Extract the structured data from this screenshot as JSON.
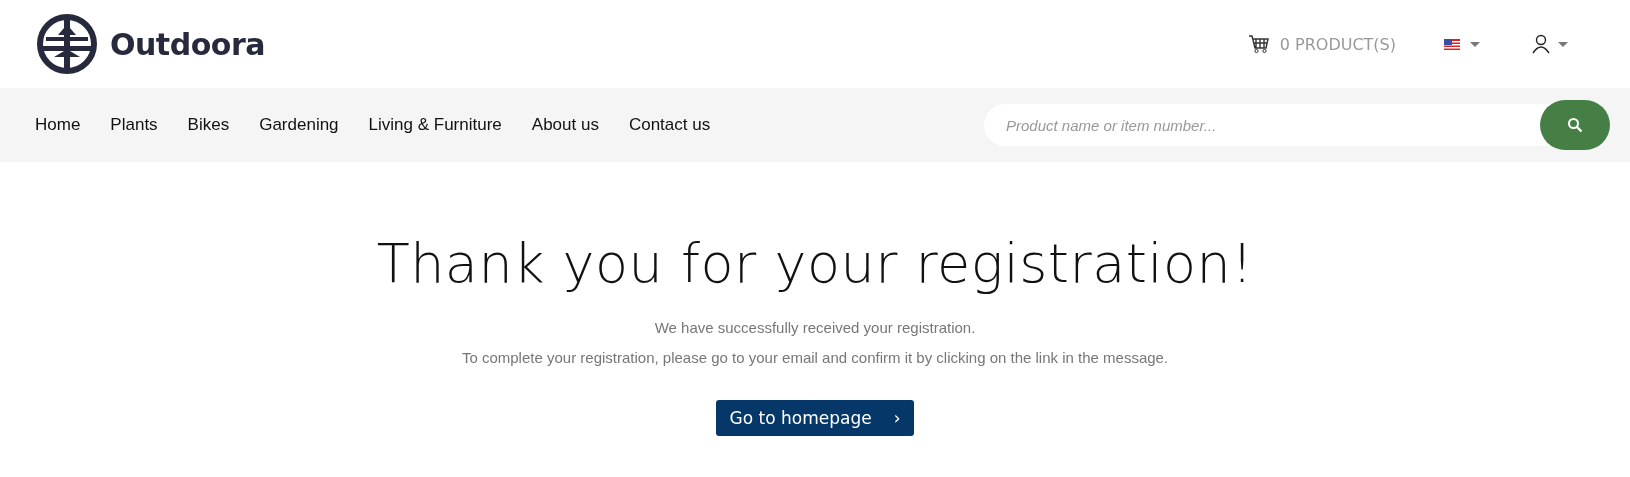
{
  "brand": {
    "name": "Outdoora"
  },
  "header": {
    "cart_label": "0 PRODUCT(S)"
  },
  "nav": {
    "items": [
      {
        "label": "Home"
      },
      {
        "label": "Plants"
      },
      {
        "label": "Bikes"
      },
      {
        "label": "Gardening"
      },
      {
        "label": "Living & Furniture"
      },
      {
        "label": "About us"
      },
      {
        "label": "Contact us"
      }
    ]
  },
  "search": {
    "placeholder": "Product name or item number..."
  },
  "main": {
    "title": "Thank you for your registration!",
    "lines": [
      "We have successfully received your registration.",
      "To complete your registration, please go to your email and confirm it by clicking on the link in the message."
    ],
    "button": {
      "label": "Go to homepage",
      "arrow": "›"
    }
  }
}
